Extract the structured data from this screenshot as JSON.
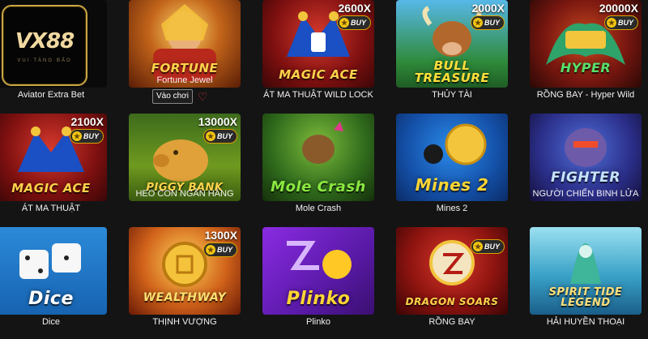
{
  "brand": {
    "logo_text": "VX88",
    "logo_sub": "VUI·TÀNG·BẢO"
  },
  "play_label": "Vào chơi",
  "jackpots": {
    "magic_ace_wild": "2600X",
    "bull": "2000X",
    "hyper": "20000X",
    "magic_ace": "2100X",
    "piggy": "13000X",
    "wealthway": "1300X"
  },
  "buy_label": "BUY",
  "games": {
    "aviator": {
      "caption": "Aviator Extra Bet"
    },
    "fortune": {
      "caption": "Fortune Jewel",
      "art": "FORTUNE"
    },
    "magic_ace_wild": {
      "caption": "ÁT MA THUẬT WILD LOCK",
      "art": "MAGIC ACE"
    },
    "bull": {
      "caption": "THỦY TÀI",
      "art": "BULL TREASURE"
    },
    "hyper": {
      "caption": "RỒNG BAY - Hyper Wild",
      "art": "HYPER"
    },
    "magic_ace": {
      "caption": "ÁT MA THUẬT",
      "art": "MAGIC ACE"
    },
    "piggy": {
      "caption": "HEO CON NGÂN HÀNG",
      "art": "PIGGY BANK"
    },
    "mole": {
      "caption": "Mole Crash",
      "art": "Mole Crash"
    },
    "mines": {
      "caption": "Mines 2",
      "art": "Mines 2"
    },
    "fighter": {
      "caption": "NGƯỜI CHIẾN BINH LỬA",
      "art": "FIGHTER"
    },
    "dice": {
      "caption": "Dice",
      "art": "Dice"
    },
    "wealthway": {
      "caption": "THỊNH VƯỢNG",
      "art": "WEALTHWAY"
    },
    "plinko": {
      "caption": "Plinko",
      "art": "Plinko"
    },
    "dragon": {
      "caption": "RỒNG BAY",
      "art": "DRAGON SOARS"
    },
    "spirit": {
      "caption": "HẢI HUYỀN THOẠI",
      "art": "SPIRIT TIDE LEGEND"
    }
  }
}
